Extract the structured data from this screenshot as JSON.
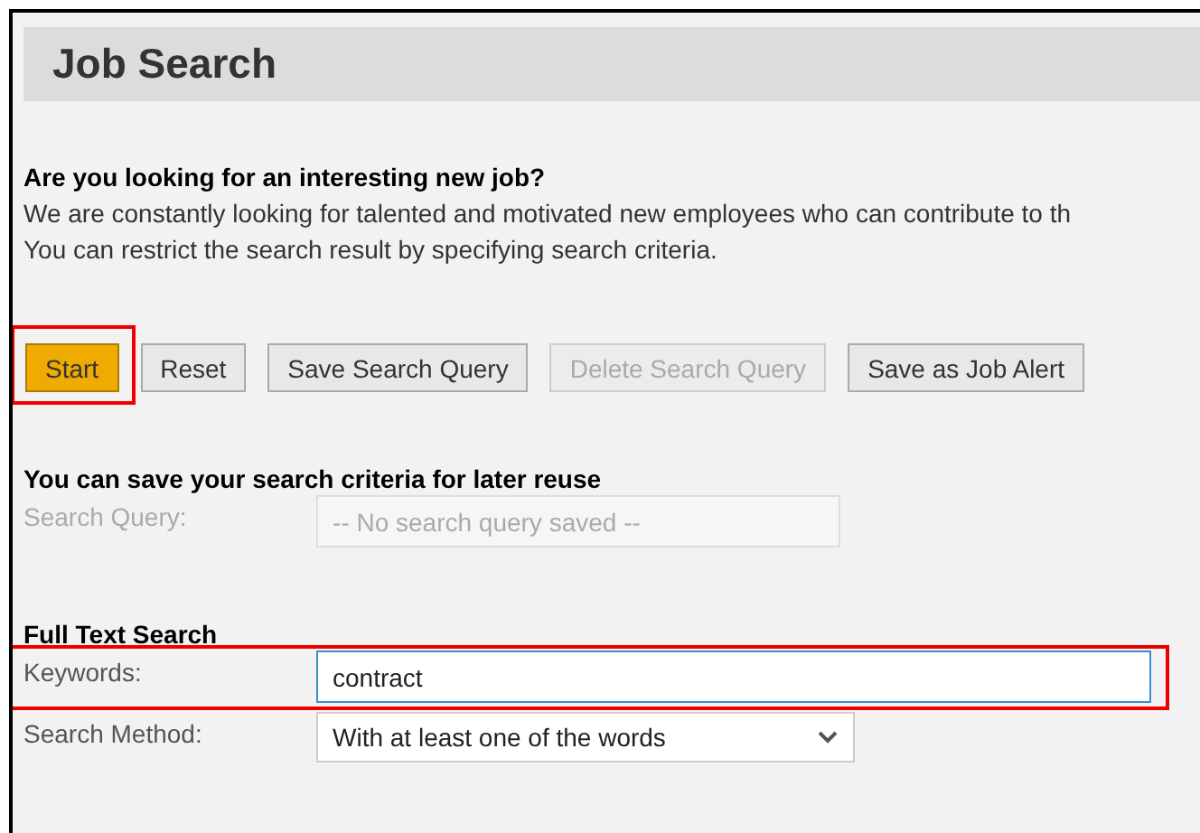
{
  "title": "Job Search",
  "intro": {
    "heading": "Are you looking for an interesting new job?",
    "lines": [
      "We are constantly looking for talented and motivated new employees who can contribute to th",
      "You can restrict the search result by specifying search criteria."
    ]
  },
  "buttons": [
    {
      "label": "Start",
      "kind": "primary",
      "disabled": false,
      "highlighted": true
    },
    {
      "label": "Reset",
      "kind": "default",
      "disabled": false,
      "highlighted": false
    },
    {
      "label": "Save Search Query",
      "kind": "default",
      "disabled": false,
      "highlighted": false
    },
    {
      "label": "Delete Search Query",
      "kind": "default",
      "disabled": true,
      "highlighted": false
    },
    {
      "label": "Save as Job Alert",
      "kind": "default",
      "disabled": false,
      "highlighted": false
    }
  ],
  "sections": [
    {
      "heading": "You can save your search criteria for later reuse",
      "fields": [
        {
          "label": "Search Query:",
          "kind": "text",
          "placeholder": "-- No search query saved --",
          "disabled": true,
          "highlighted": false
        }
      ]
    },
    {
      "heading": "Full Text Search",
      "fields": [
        {
          "label": "Keywords:",
          "kind": "text",
          "value": "contract",
          "disabled": false,
          "highlighted": true
        },
        {
          "label": "Search Method:",
          "kind": "select",
          "value": "With at least one of the words",
          "disabled": false,
          "highlighted": false
        }
      ]
    }
  ]
}
